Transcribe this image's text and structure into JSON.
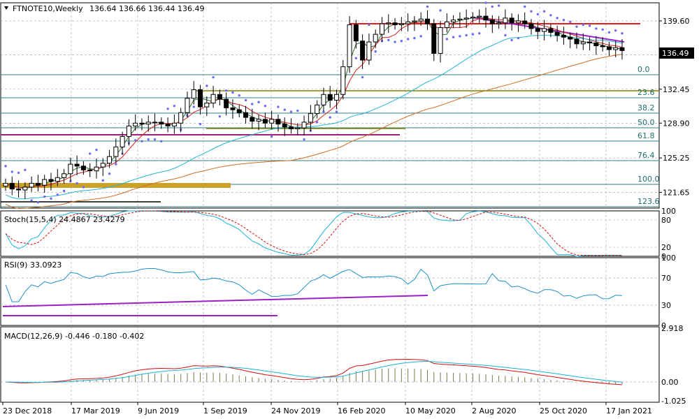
{
  "header": {
    "symbol": "FTNOTE10,Weekly",
    "ohlc": "136.64 136.66 136.44 136.49"
  },
  "current_price": "136.49",
  "x_labels": [
    "23 Dec 2018",
    "17 Mar 2019",
    "9 Jun 2019",
    "1 Sep 2019",
    "24 Nov 2019",
    "16 Feb 2020",
    "10 May 2020",
    "2 Aug 2020",
    "25 Oct 2020",
    "17 Jan 2021"
  ],
  "price_axis": {
    "ticks": [
      "139.60",
      "136.05",
      "132.45",
      "128.90",
      "125.25",
      "121.65"
    ],
    "tick_values": [
      139.6,
      136.05,
      132.45,
      128.9,
      125.25,
      121.65
    ]
  },
  "fibo": [
    "0.0",
    "23.6",
    "38.2",
    "50.0",
    "61.8",
    "76.4",
    "100.0",
    "123.6"
  ],
  "stoch": {
    "label": "Stoch(15,5,4) 24.4867 23.4279",
    "ticks": [
      "100",
      "80",
      "20",
      "0"
    ]
  },
  "rsi": {
    "label": "RSI(9) 33.0923",
    "ticks": [
      "100",
      "70",
      "30",
      "0"
    ]
  },
  "macd": {
    "label": "MACD(12,26,9) -0.446 -0.180 -0.402",
    "ticks": [
      "2.918",
      "0.00",
      "-1.025"
    ]
  },
  "colors": {
    "grid": "#9aa0a6",
    "fast_ma": "#2e6b2e",
    "slow_ma": "#d62020",
    "ma_long1": "#27b3d6",
    "ma_long2": "#d26c22",
    "sar": "#6b6cf2",
    "fib_line": "#2f7f85",
    "red_res": "#e02020",
    "trend": "#9b20c8",
    "olive": "#808000",
    "gold": "#c9a227",
    "macd": "#d01010",
    "signal": "#1ab0d8",
    "hist": "#7a7a45"
  },
  "chart_data": {
    "type": "candlestick",
    "timeframe": "Weekly",
    "x_range": [
      "2018-12-23",
      "2021-01-24"
    ],
    "price_range": [
      120.0,
      141.5
    ],
    "closes": [
      122.6,
      122.0,
      121.9,
      122.2,
      122.6,
      122.4,
      123.0,
      122.8,
      123.2,
      123.6,
      124.6,
      124.4,
      124.0,
      123.9,
      124.3,
      124.7,
      125.4,
      126.4,
      127.5,
      128.6,
      128.9,
      128.8,
      129.0,
      129.0,
      128.8,
      128.6,
      128.9,
      130.0,
      131.5,
      132.4,
      130.6,
      131.0,
      131.9,
      131.4,
      130.5,
      130.3,
      130.0,
      129.5,
      129.1,
      129.3,
      128.9,
      129.3,
      128.8,
      128.5,
      128.3,
      128.4,
      129.0,
      129.9,
      130.8,
      131.9,
      131.3,
      131.9,
      134.8,
      139.2,
      137.5,
      135.5,
      137.4,
      138.2,
      139.3,
      139.4,
      139.2,
      139.3,
      139.5,
      139.6,
      139.8,
      139.3,
      136.2,
      138.9,
      139.5,
      139.7,
      139.8,
      139.9,
      140.0,
      140.1,
      139.7,
      139.3,
      139.4,
      139.9,
      139.4,
      139.6,
      139.3,
      138.8,
      138.5,
      138.8,
      138.4,
      138.1,
      137.9,
      137.7,
      137.2,
      137.4,
      137.3,
      137.0,
      136.9,
      136.6,
      136.8,
      136.5
    ],
    "ema_fast_note": "green moving average",
    "sma_slow_note": "red moving average",
    "horizontal_levels": [
      139.6,
      138.1,
      136.05,
      132.45,
      130.1,
      129.0,
      128.6,
      128.0,
      127.7,
      126.5,
      125.25,
      121.65
    ],
    "fibo_levels": [
      "0.0",
      "23.6",
      "38.2",
      "50.0",
      "61.8",
      "76.4",
      "100.0",
      "123.6"
    ],
    "stoch": {
      "k": 24.4867,
      "d": 23.4279,
      "levels": [
        20,
        80
      ],
      "range": [
        0,
        100
      ]
    },
    "rsi": {
      "value": 33.0923,
      "levels": [
        30,
        70
      ],
      "range": [
        0,
        100
      ]
    },
    "macd": {
      "macd": -0.446,
      "signal": -0.18,
      "hist": -0.402,
      "range": [
        -1.025,
        2.918
      ]
    }
  }
}
